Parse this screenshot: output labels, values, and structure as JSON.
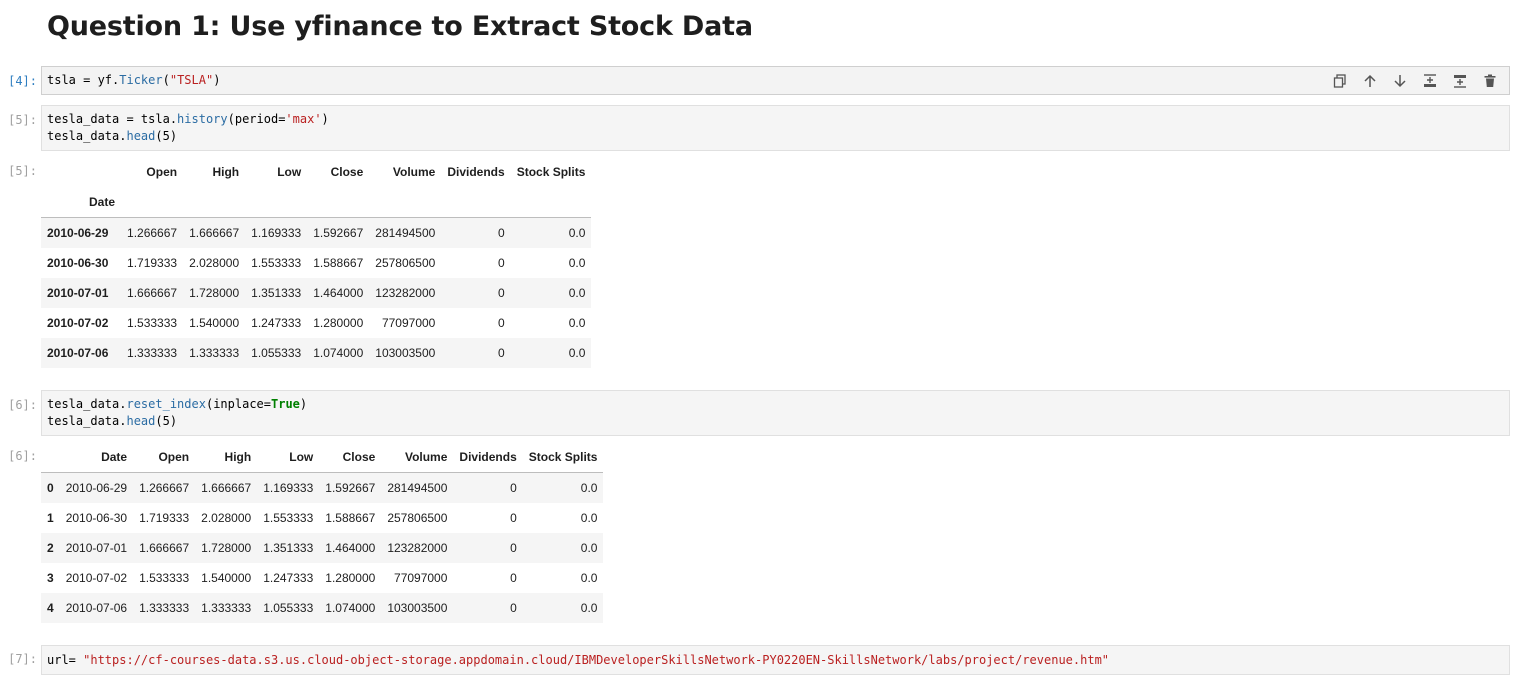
{
  "heading": "Question 1: Use yfinance to Extract Stock Data",
  "cells": [
    {
      "in_prompt": "[4]:",
      "line1": {
        "a": "tsla = yf.",
        "b": "Ticker",
        "c": "(",
        "d": "\"TSLA\"",
        "e": ")"
      }
    },
    {
      "in_prompt": "[5]:",
      "line1": {
        "a": "tesla_data = tsla.",
        "b": "history",
        "c": "(period=",
        "d": "'max'",
        "e": ")"
      },
      "line2": {
        "a": "tesla_data.",
        "b": "head",
        "c": "(5)"
      }
    },
    {
      "in_prompt": "[6]:",
      "line1": {
        "a": "tesla_data.",
        "b": "reset_index",
        "c": "(inplace=",
        "d": "True",
        "e": ")"
      },
      "line2": {
        "a": "tesla_data.",
        "b": "head",
        "c": "(5)"
      }
    },
    {
      "in_prompt": "[7]:",
      "line1": {
        "a": "url= ",
        "b": "\"https://cf-courses-data.s3.us.cloud-object-storage.appdomain.cloud/IBMDeveloperSkillsNetwork-PY0220EN-SkillsNetwork/labs/project/revenue.htm\""
      }
    }
  ],
  "outputs": [
    {
      "out_prompt": "[5]:",
      "index_name": "Date"
    },
    {
      "out_prompt": "[6]:"
    }
  ],
  "toolbar": {
    "icons": [
      "copy-icon",
      "move-up-icon",
      "move-down-icon",
      "insert-above-icon",
      "insert-below-icon",
      "delete-icon"
    ]
  },
  "table1": {
    "columns": [
      "Open",
      "High",
      "Low",
      "Close",
      "Volume",
      "Dividends",
      "Stock Splits"
    ],
    "rows": [
      {
        "index": "2010-06-29",
        "values": [
          "1.266667",
          "1.666667",
          "1.169333",
          "1.592667",
          "281494500",
          "0",
          "0.0"
        ]
      },
      {
        "index": "2010-06-30",
        "values": [
          "1.719333",
          "2.028000",
          "1.553333",
          "1.588667",
          "257806500",
          "0",
          "0.0"
        ]
      },
      {
        "index": "2010-07-01",
        "values": [
          "1.666667",
          "1.728000",
          "1.351333",
          "1.464000",
          "123282000",
          "0",
          "0.0"
        ]
      },
      {
        "index": "2010-07-02",
        "values": [
          "1.533333",
          "1.540000",
          "1.247333",
          "1.280000",
          "77097000",
          "0",
          "0.0"
        ]
      },
      {
        "index": "2010-07-06",
        "values": [
          "1.333333",
          "1.333333",
          "1.055333",
          "1.074000",
          "103003500",
          "0",
          "0.0"
        ]
      }
    ]
  },
  "table2": {
    "columns": [
      "Date",
      "Open",
      "High",
      "Low",
      "Close",
      "Volume",
      "Dividends",
      "Stock Splits"
    ],
    "rows": [
      {
        "index": "0",
        "values": [
          "2010-06-29",
          "1.266667",
          "1.666667",
          "1.169333",
          "1.592667",
          "281494500",
          "0",
          "0.0"
        ]
      },
      {
        "index": "1",
        "values": [
          "2010-06-30",
          "1.719333",
          "2.028000",
          "1.553333",
          "1.588667",
          "257806500",
          "0",
          "0.0"
        ]
      },
      {
        "index": "2",
        "values": [
          "2010-07-01",
          "1.666667",
          "1.728000",
          "1.351333",
          "1.464000",
          "123282000",
          "0",
          "0.0"
        ]
      },
      {
        "index": "3",
        "values": [
          "2010-07-02",
          "1.533333",
          "1.540000",
          "1.247333",
          "1.280000",
          "77097000",
          "0",
          "0.0"
        ]
      },
      {
        "index": "4",
        "values": [
          "2010-07-06",
          "1.333333",
          "1.333333",
          "1.055333",
          "1.074000",
          "103003500",
          "0",
          "0.0"
        ]
      }
    ]
  }
}
